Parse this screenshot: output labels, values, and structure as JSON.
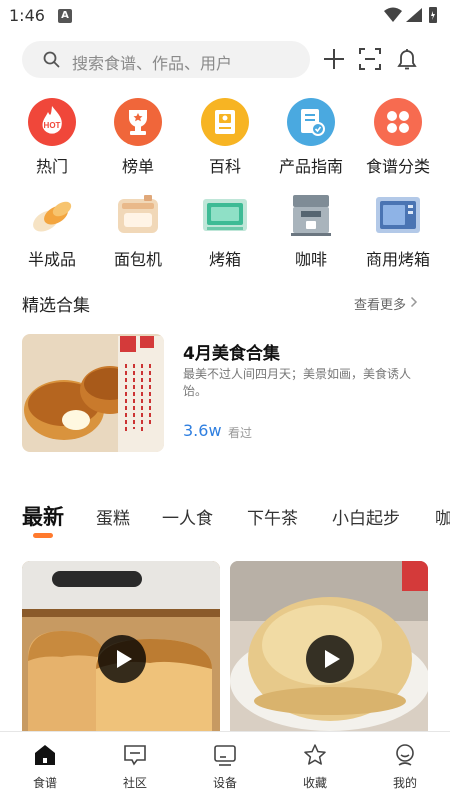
{
  "status_bar": {
    "time": "1:46",
    "badge": "A"
  },
  "search": {
    "placeholder": "搜索食谱、作品、用户"
  },
  "top_actions": [
    "add-icon",
    "scan-icon",
    "bell-icon"
  ],
  "categories_row1": [
    {
      "label": "热门",
      "icon": "hot-icon",
      "color": "#f0473a"
    },
    {
      "label": "榜单",
      "icon": "trophy-icon",
      "color": "#f0663a"
    },
    {
      "label": "百科",
      "icon": "book-icon",
      "color": "#f7b423"
    },
    {
      "label": "产品指南",
      "icon": "guide-icon",
      "color": "#4aa9e0"
    },
    {
      "label": "食谱分类",
      "icon": "category-icon",
      "color": "#f76b50"
    }
  ],
  "categories_row2": [
    {
      "label": "半成品",
      "icon": "semi-finished-icon"
    },
    {
      "label": "面包机",
      "icon": "bread-machine-icon"
    },
    {
      "label": "烤箱",
      "icon": "oven-icon"
    },
    {
      "label": "咖啡",
      "icon": "coffee-machine-icon"
    },
    {
      "label": "商用烤箱",
      "icon": "commercial-oven-icon"
    }
  ],
  "section": {
    "title": "精选合集",
    "more": "查看更多"
  },
  "collection": {
    "title": "4月美食合集",
    "desc": "最美不过人间四月天；美景如画，美食诱人饴。",
    "views": "3.6w",
    "views_label": "看过"
  },
  "tabs": [
    "最新",
    "蛋糕",
    "一人食",
    "下午茶",
    "小白起步",
    "咖"
  ],
  "bottom_nav": [
    {
      "label": "食谱",
      "icon": "home-icon",
      "active": true
    },
    {
      "label": "社区",
      "icon": "chat-icon"
    },
    {
      "label": "设备",
      "icon": "device-icon"
    },
    {
      "label": "收藏",
      "icon": "star-icon"
    },
    {
      "label": "我的",
      "icon": "profile-icon"
    }
  ],
  "colors": {
    "accent": "#ff7a2e",
    "link": "#2f7fe0"
  }
}
